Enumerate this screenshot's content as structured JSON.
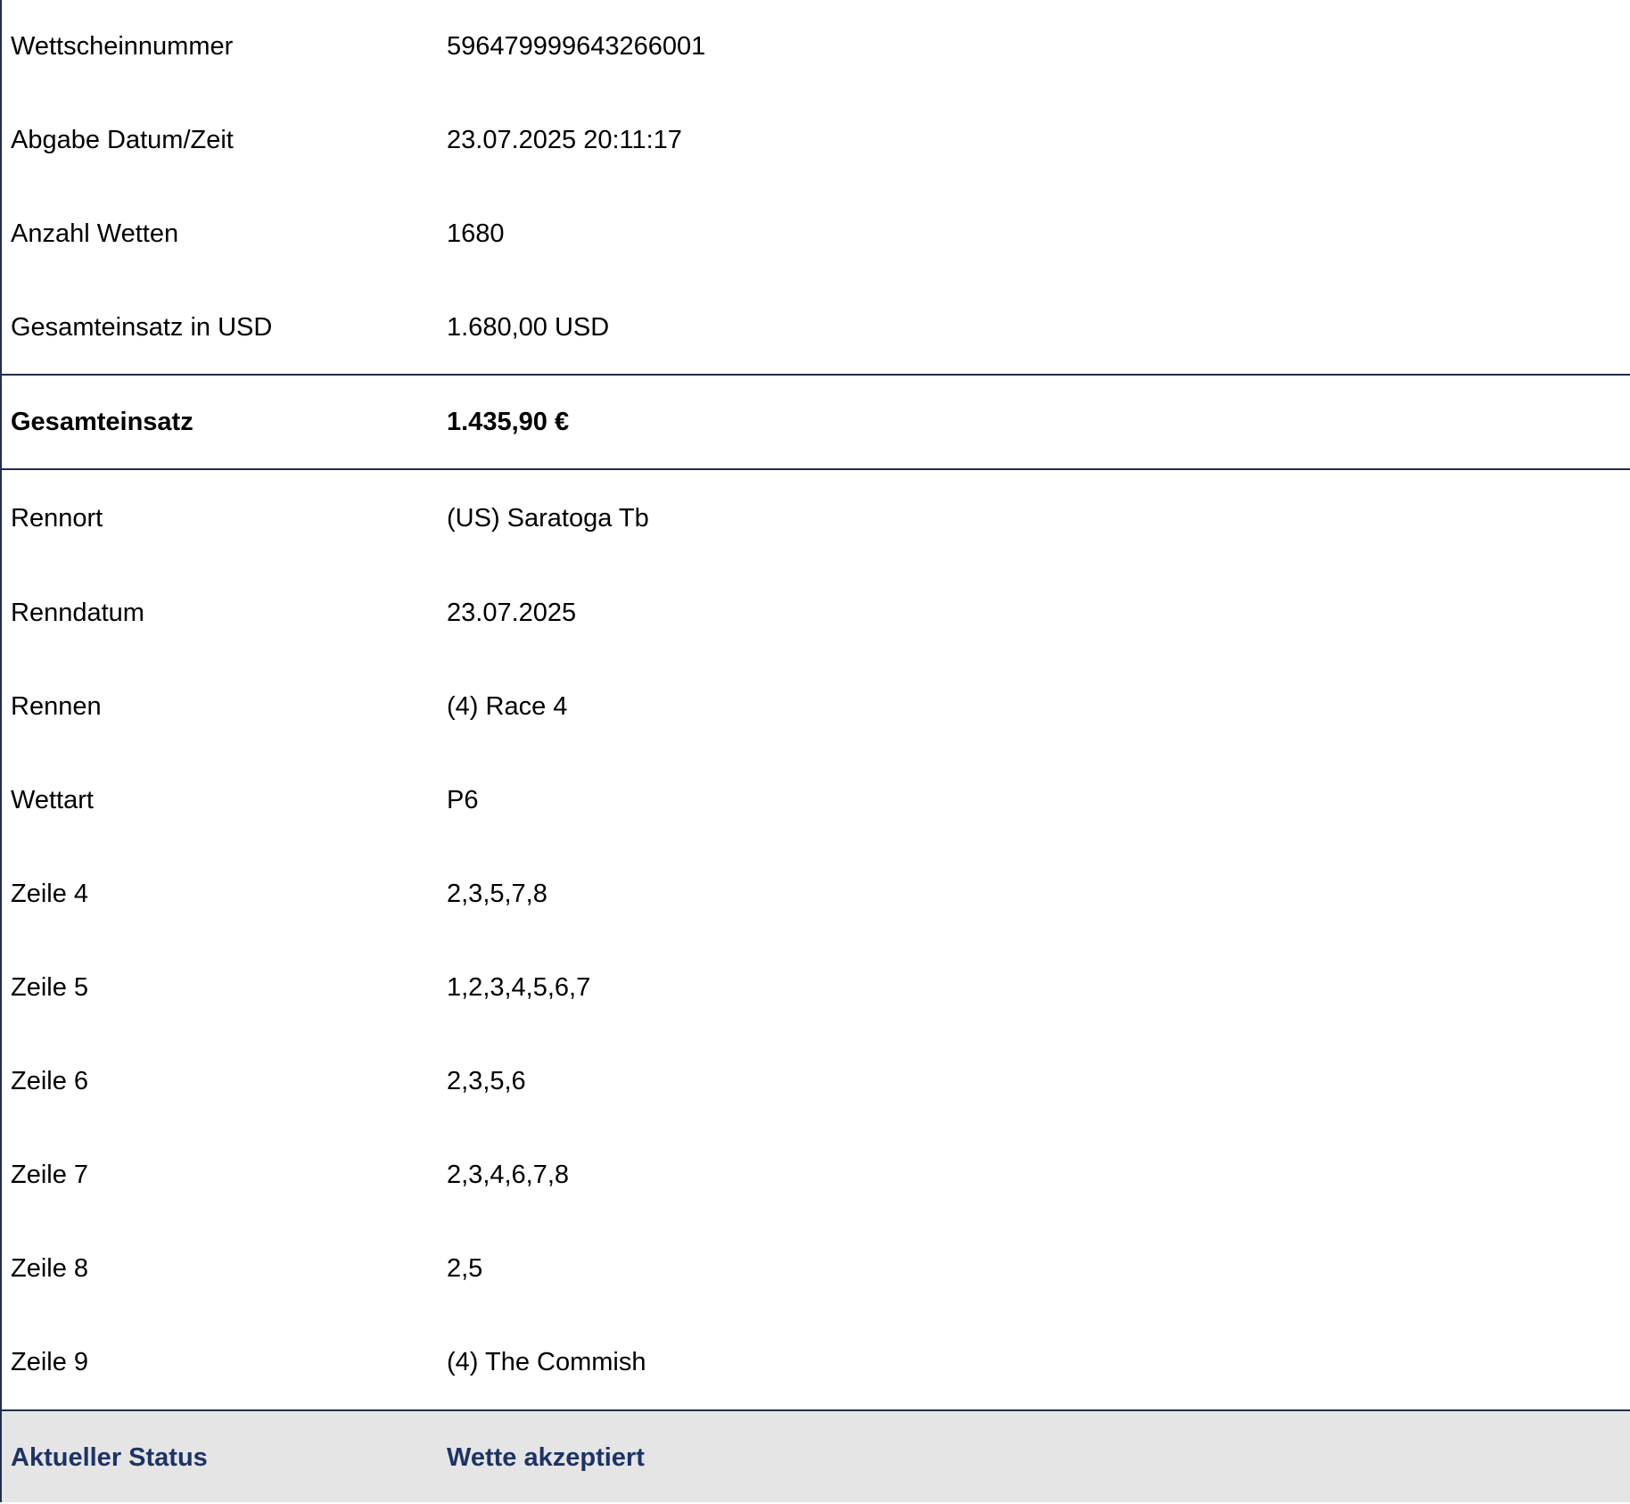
{
  "ticket_info": [
    {
      "label": "Wettscheinnummer",
      "value": "596479999643266001"
    },
    {
      "label": "Abgabe Datum/Zeit",
      "value": "23.07.2025 20:11:17"
    },
    {
      "label": "Anzahl Wetten",
      "value": "1680"
    },
    {
      "label": "Gesamteinsatz in USD",
      "value": "1.680,00 USD"
    }
  ],
  "total": {
    "label": "Gesamteinsatz",
    "value": "1.435,90 €"
  },
  "race_info": [
    {
      "label": "Rennort",
      "value": "(US) Saratoga Tb"
    },
    {
      "label": "Renndatum",
      "value": "23.07.2025"
    },
    {
      "label": "Rennen",
      "value": "(4) Race 4"
    },
    {
      "label": "Wettart",
      "value": "P6"
    },
    {
      "label": "Zeile 4",
      "value": "2,3,5,7,8"
    },
    {
      "label": "Zeile 5",
      "value": "1,2,3,4,5,6,7"
    },
    {
      "label": "Zeile 6",
      "value": "2,3,5,6"
    },
    {
      "label": "Zeile 7",
      "value": "2,3,4,6,7,8"
    },
    {
      "label": "Zeile 8",
      "value": "2,5"
    },
    {
      "label": "Zeile 9",
      "value": "(4) The Commish"
    }
  ],
  "status": {
    "label": "Aktueller Status",
    "value": "Wette akzeptiert"
  },
  "colors": {
    "border": "#1f2f4d",
    "status_text": "#1d3366",
    "status_background": "#e5e5e5"
  }
}
